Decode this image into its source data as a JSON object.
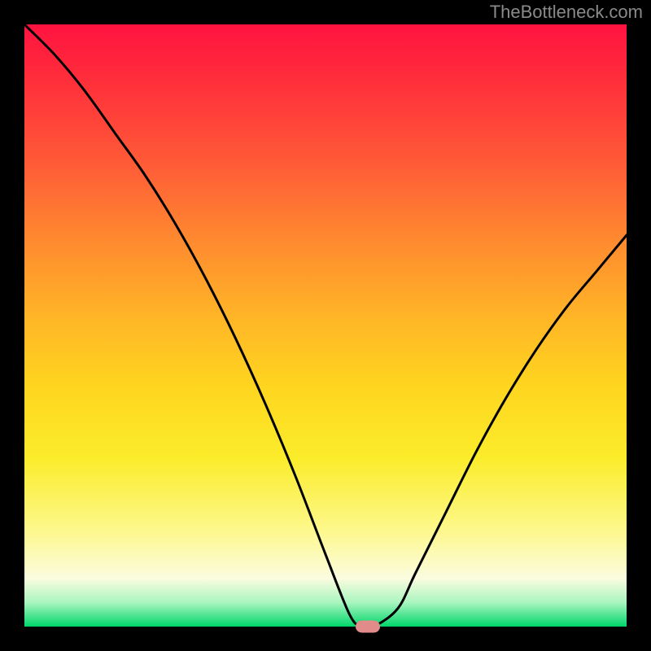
{
  "attribution": "TheBottleneck.com",
  "chart_data": {
    "type": "line",
    "title": "",
    "xlabel": "",
    "ylabel": "",
    "xlim": [
      0,
      100
    ],
    "ylim": [
      0,
      1
    ],
    "grid": false,
    "series": [
      {
        "name": "bottleneck-curve",
        "x": [
          0,
          5,
          10,
          15,
          20,
          25,
          30,
          35,
          40,
          45,
          50,
          54,
          56,
          58,
          62,
          65,
          70,
          75,
          80,
          85,
          90,
          95,
          100
        ],
        "values": [
          1.0,
          0.95,
          0.89,
          0.82,
          0.75,
          0.67,
          0.58,
          0.48,
          0.37,
          0.25,
          0.12,
          0.02,
          0.0,
          0.0,
          0.03,
          0.09,
          0.19,
          0.29,
          0.38,
          0.46,
          0.53,
          0.59,
          0.65
        ]
      }
    ],
    "marker": {
      "x": 57,
      "y": 0.0,
      "color": "#e28b8b"
    },
    "colors": {
      "curve": "#000000",
      "gradient_top": "#ff1340",
      "gradient_bottom": "#00d66a"
    }
  }
}
